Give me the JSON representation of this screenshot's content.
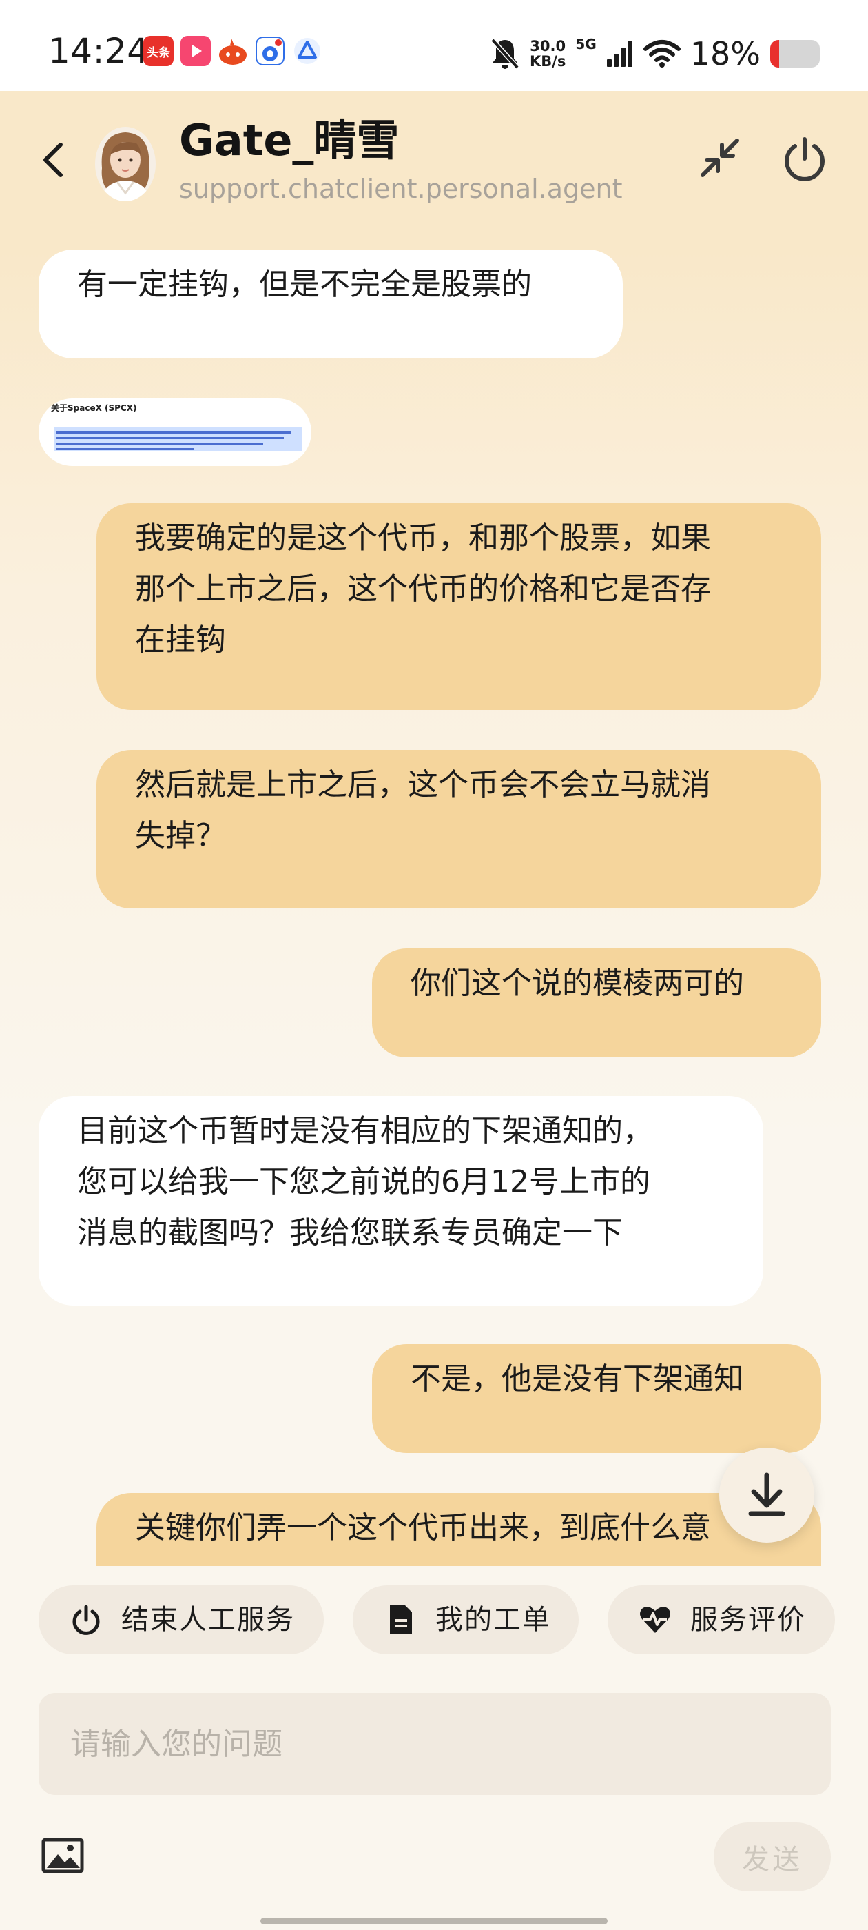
{
  "status_bar": {
    "time": "14:24",
    "app_icons": [
      "toutiao-icon",
      "video-app-icon",
      "fire-app-icon",
      "baidu-icon",
      "triangle-app-icon"
    ],
    "news_badge": "头条",
    "net_speed_value": "30.0",
    "net_speed_unit": "KB/s",
    "network_type": "5G",
    "battery_percent": "18%",
    "battery_level": 0.18
  },
  "header": {
    "agent_name": "Gate_晴雪",
    "agent_id": "support.chatclient.personal.agent"
  },
  "messages": [
    {
      "side": "in",
      "type": "text",
      "text": "有一定挂钩，但是不完全是股票的"
    },
    {
      "side": "in",
      "type": "image",
      "image_title": "关于SpaceX (SPCX)"
    },
    {
      "side": "out",
      "type": "text",
      "text": "我要确定的是这个代币，和那个股票，如果\n那个上市之后，这个代币的价格和它是否存\n在挂钩"
    },
    {
      "side": "out",
      "type": "text",
      "text": "然后就是上市之后，这个币会不会立马就消\n失掉？"
    },
    {
      "side": "out",
      "type": "text",
      "text": "你们这个说的模棱两可的"
    },
    {
      "side": "in",
      "type": "text",
      "text": "目前这个币暂时是没有相应的下架通知的，\n您可以给我一下您之前说的6月12号上市的\n消息的截图吗？我给您联系专员确定一下"
    },
    {
      "side": "out",
      "type": "text",
      "text": "不是，他是没有下架通知"
    },
    {
      "side": "out",
      "type": "text",
      "text": "关键你们弄一个这个代币出来，到底什么意"
    }
  ],
  "actions": [
    {
      "label": "结束人工服务",
      "icon": "power-icon"
    },
    {
      "label": "我的工单",
      "icon": "document-icon"
    },
    {
      "label": "服务评价",
      "icon": "heart-icon"
    }
  ],
  "composer": {
    "placeholder": "请输入您的问题",
    "value": "",
    "send_label": "发送"
  },
  "colors": {
    "header_bg": "#f9e8c9",
    "outgoing_bubble": "#f5d59c",
    "incoming_bubble": "#ffffff",
    "chip_bg": "#f1eae0"
  }
}
